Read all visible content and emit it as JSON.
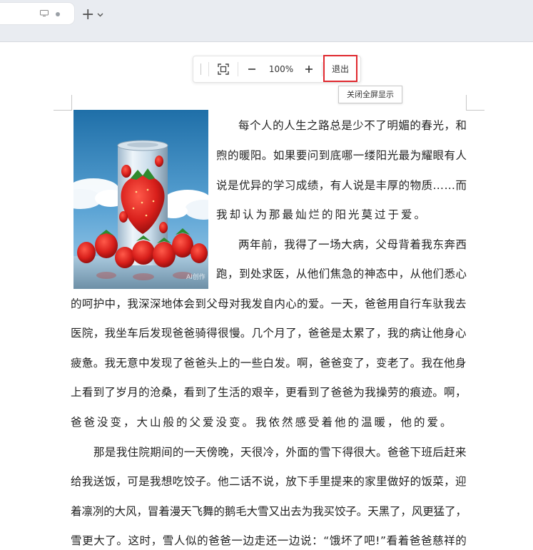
{
  "browser": {
    "new_tab_symbol": "+"
  },
  "toolbar": {
    "zoom_level": "100%",
    "exit_label": "退出",
    "tooltip": "关闭全屏显示"
  },
  "image": {
    "watermark": "AI创作"
  },
  "article": {
    "lines": [
      "每个人的人生之路总是少不了明媚的春光，和",
      "煦的暖阳。如果要问到底哪一缕阳光最为耀眼有人",
      "说是优异的学习成绩，有人说是丰厚的物质……而",
      "我却认为那最灿烂的阳光莫过于爱。",
      "两年前，我得了一场大病，父母背着我东奔西",
      "跑，到处求医，从他们焦急的神态中，从他们悉心",
      "的呵护中，我深深地体会到父母对我发自内心的爱。一天，爸爸用自行车驮我去",
      "医院，我坐车后发现爸爸骑得很慢。几个月了，爸爸是太累了，我的病让他身心",
      "疲惫。我无意中发现了爸爸头上的一些白发。啊，爸爸变了，变老了。我在他身",
      "上看到了岁月的沧桑，看到了生活的艰辛，更看到了爸爸为我操劳的痕迹。啊，",
      "爸爸没变，大山般的父爱没变。我依然感受着他的温暖，他的爱。",
      "那是我住院期间的一天傍晚，天很冷，外面的雪下得很大。爸爸下班后赶来",
      "给我送饭，可是我想吃饺子。他二话不说，放下手里提来的家里做好的饭菜，迎",
      "着凛冽的大风，冒着漫天飞舞的鹅毛大雪又出去为我买饺子。天黑了，风更猛了，",
      "雪更大了。这时，雪人似的爸爸一边走还一边说：“饿坏了吧!”看着爸爸慈祥的"
    ]
  }
}
